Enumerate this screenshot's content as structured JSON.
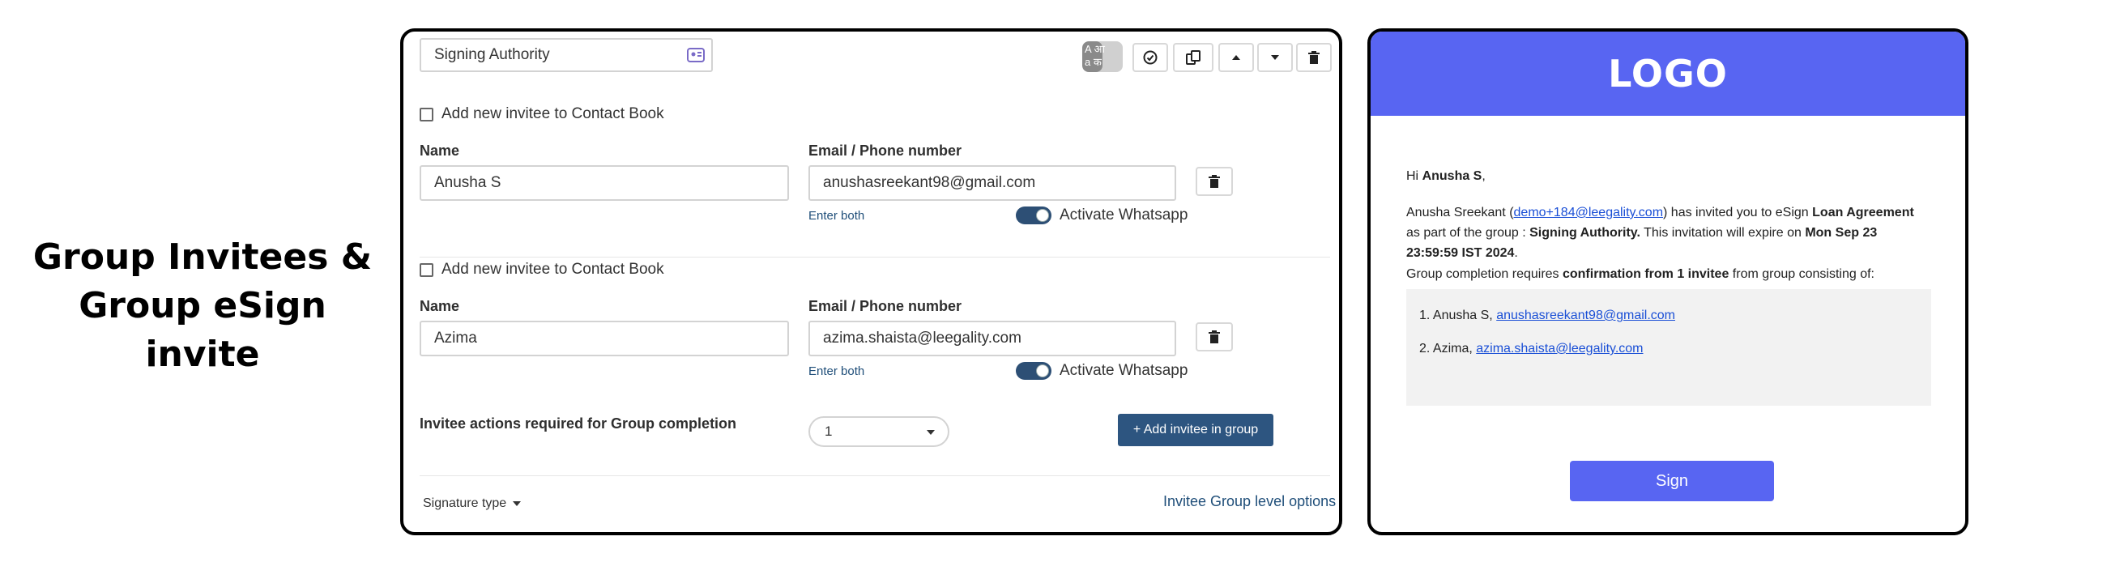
{
  "caption": {
    "line1": "Group Invitees &",
    "line2": "Group eSign invite"
  },
  "form": {
    "group_name_value": "Signing Authority",
    "toolbar": {
      "language_icon_top": "A आ",
      "language_icon_bottom": "a क"
    },
    "invitees": [
      {
        "contact_book_label": "Add new invitee to Contact Book",
        "name_label": "Name",
        "name_value": "Anusha S",
        "email_label": "Email / Phone number",
        "email_value": "anushasreekant98@gmail.com",
        "enter_both": "Enter both",
        "whatsapp_label": "Activate Whatsapp"
      },
      {
        "contact_book_label": "Add new invitee to Contact Book",
        "name_label": "Name",
        "name_value": "Azima",
        "email_label": "Email / Phone number",
        "email_value": "azima.shaista@leegality.com",
        "enter_both": "Enter both",
        "whatsapp_label": "Activate Whatsapp"
      }
    ],
    "completion_label": "Invitee actions required for Group completion",
    "completion_value": "1",
    "add_invitee_label": "+ Add invitee in group",
    "signature_type_label": "Signature type",
    "group_options_label": "Invitee Group level options"
  },
  "email": {
    "logo": "LOGO",
    "greeting_prefix": "Hi ",
    "greeting_name": "Anusha S",
    "greeting_suffix": ",",
    "inviter_name": "Anusha Sreekant (",
    "inviter_email": "demo+184@leegality.com",
    "invited_text": ") has invited you to eSign ",
    "doc_name": "Loan Agreement",
    "part_of_text": "as part of the group : ",
    "group_name": "Signing Authority.",
    "expire_text": " This invitation will expire on ",
    "expire_date_1": "Mon Sep 23",
    "expire_date_2": "23:59:59 IST 2024",
    "period": ".",
    "completion_prefix": "Group completion requires ",
    "completion_bold": "confirmation from 1 invitee",
    "completion_suffix": " from group consisting of:",
    "members": [
      {
        "prefix": "1. Anusha S, ",
        "email": "anushasreekant98@gmail.com"
      },
      {
        "prefix": "2. Azima, ",
        "email": "azima.shaista@leegality.com"
      }
    ],
    "sign_label": "Sign"
  }
}
